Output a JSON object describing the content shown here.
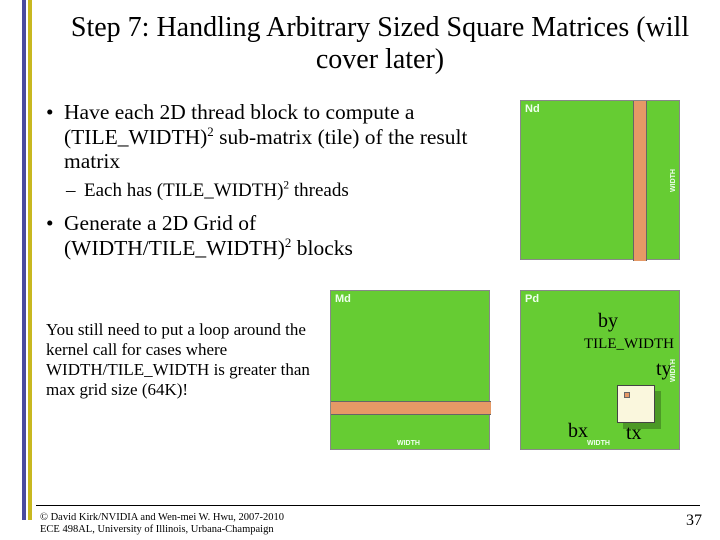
{
  "title": "Step 7: Handling Arbitrary Sized Square Matrices (will cover later)",
  "bullets": {
    "b1_pre": "Have each 2D thread block to compute a (TILE_WIDTH)",
    "b1_post": " sub-matrix (tile) of the result matrix",
    "s1_pre": "Each has (TILE_WIDTH)",
    "s1_post": " threads",
    "b2_pre": "Generate a 2D Grid of (WIDTH/TILE_WIDTH)",
    "b2_post": " blocks",
    "sq": "2"
  },
  "note": "You still need to put a loop around the kernel call for cases where WIDTH/TILE_WIDTH is greater than max grid size (64K)!",
  "diagram": {
    "nd": "Nd",
    "md": "Md",
    "pd": "Pd",
    "width": "WIDTH",
    "by": "by",
    "bx": "bx",
    "ty": "ty",
    "tx": "tx",
    "tile_width": "TILE_WIDTH"
  },
  "footer": {
    "copyright_l1": "© David Kirk/NVIDIA and Wen-mei W. Hwu, 2007-2010",
    "copyright_l2": "ECE 498AL, University of Illinois, Urbana-Champaign",
    "slidenum": "37"
  }
}
